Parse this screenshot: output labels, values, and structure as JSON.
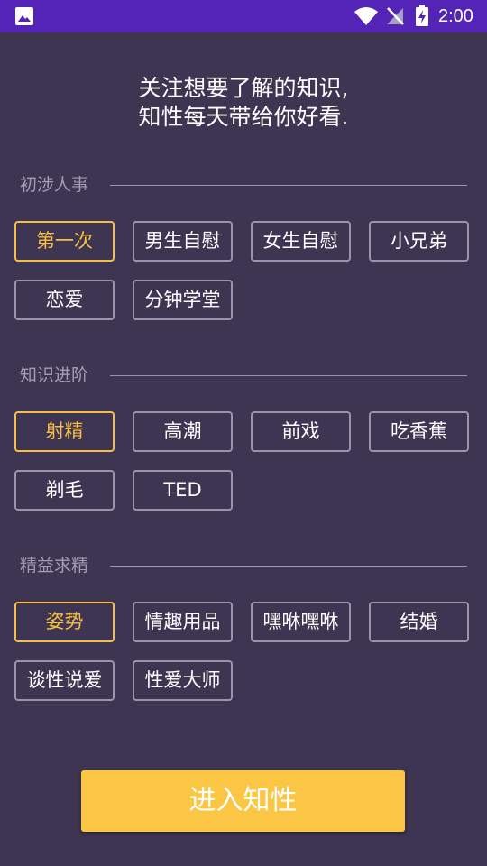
{
  "status_bar": {
    "time": "2:00",
    "icons": [
      "gallery-icon",
      "wifi-icon",
      "no-signal-icon",
      "battery-charging-icon"
    ],
    "background_color": "#5424b8"
  },
  "headline": {
    "line1": "关注想要了解的知识,",
    "line2": "知性每天带给你好看."
  },
  "sections": [
    {
      "title": "初涉人事",
      "tags": [
        {
          "label": "第一次",
          "selected": true
        },
        {
          "label": "男生自慰",
          "selected": false
        },
        {
          "label": "女生自慰",
          "selected": false
        },
        {
          "label": "小兄弟",
          "selected": false
        },
        {
          "label": "恋爱",
          "selected": false
        },
        {
          "label": "分钟学堂",
          "selected": false
        }
      ]
    },
    {
      "title": "知识进阶",
      "tags": [
        {
          "label": "射精",
          "selected": true
        },
        {
          "label": "高潮",
          "selected": false
        },
        {
          "label": "前戏",
          "selected": false
        },
        {
          "label": "吃香蕉",
          "selected": false
        },
        {
          "label": "剃毛",
          "selected": false
        },
        {
          "label": "TED",
          "selected": false
        }
      ]
    },
    {
      "title": "精益求精",
      "tags": [
        {
          "label": "姿势",
          "selected": true
        },
        {
          "label": "情趣用品",
          "selected": false
        },
        {
          "label": "嘿咻嘿咻",
          "selected": false
        },
        {
          "label": "结婚",
          "selected": false
        },
        {
          "label": "谈性说爱",
          "selected": false
        },
        {
          "label": "性爱大师",
          "selected": false
        }
      ]
    }
  ],
  "enter_button": {
    "label": "进入知性"
  },
  "colors": {
    "background": "#3d3551",
    "accent": "#f8c043",
    "button": "#fbc643",
    "tag_border": "#9a95a8"
  }
}
